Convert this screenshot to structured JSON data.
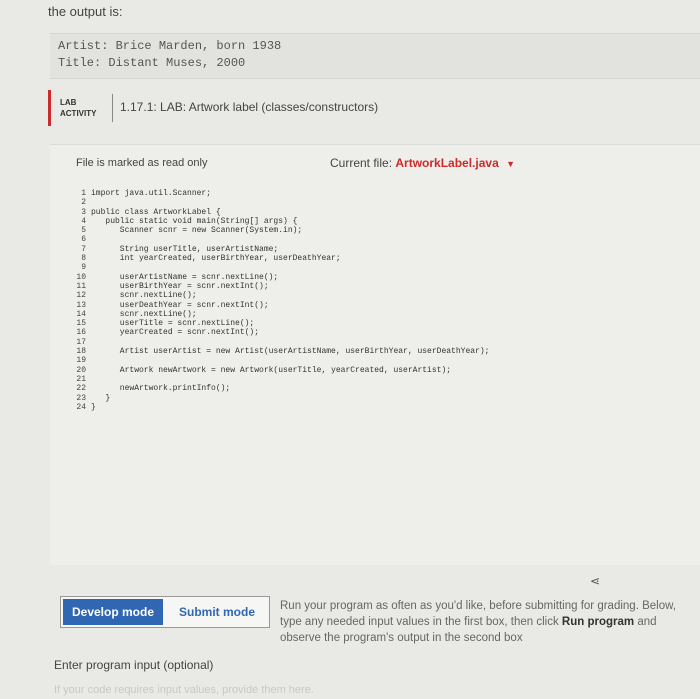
{
  "intro": "the output is:",
  "output_lines": [
    "Artist: Brice Marden, born 1938",
    "Title: Distant Muses, 2000"
  ],
  "lab": {
    "tag_line1": "LAB",
    "tag_line2": "ACTIVITY",
    "title": "1.17.1: LAB: Artwork label (classes/constructors)"
  },
  "editor": {
    "readonly_text": "File is marked as read only",
    "current_file_label": "Current file:",
    "current_file_name": "ArtworkLabel.java",
    "lines": [
      {
        "n": "1",
        "t": "import java.util.Scanner;"
      },
      {
        "n": "2",
        "t": ""
      },
      {
        "n": "3",
        "t": "public class ArtworkLabel {"
      },
      {
        "n": "4",
        "t": "   public static void main(String[] args) {"
      },
      {
        "n": "5",
        "t": "      Scanner scnr = new Scanner(System.in);"
      },
      {
        "n": "6",
        "t": ""
      },
      {
        "n": "7",
        "t": "      String userTitle, userArtistName;"
      },
      {
        "n": "8",
        "t": "      int yearCreated, userBirthYear, userDeathYear;"
      },
      {
        "n": "9",
        "t": ""
      },
      {
        "n": "10",
        "t": "      userArtistName = scnr.nextLine();"
      },
      {
        "n": "11",
        "t": "      userBirthYear = scnr.nextInt();"
      },
      {
        "n": "12",
        "t": "      scnr.nextLine();"
      },
      {
        "n": "13",
        "t": "      userDeathYear = scnr.nextInt();"
      },
      {
        "n": "14",
        "t": "      scnr.nextLine();"
      },
      {
        "n": "15",
        "t": "      userTitle = scnr.nextLine();"
      },
      {
        "n": "16",
        "t": "      yearCreated = scnr.nextInt();"
      },
      {
        "n": "17",
        "t": ""
      },
      {
        "n": "18",
        "t": "      Artist userArtist = new Artist(userArtistName, userBirthYear, userDeathYear);"
      },
      {
        "n": "19",
        "t": ""
      },
      {
        "n": "20",
        "t": "      Artwork newArtwork = new Artwork(userTitle, yearCreated, userArtist);"
      },
      {
        "n": "21",
        "t": ""
      },
      {
        "n": "22",
        "t": "      newArtwork.printInfo();"
      },
      {
        "n": "23",
        "t": "   }"
      },
      {
        "n": "24",
        "t": "}"
      }
    ]
  },
  "modes": {
    "develop": "Develop mode",
    "submit": "Submit mode"
  },
  "instructions": {
    "part1": "Run your program as often as you'd like, before submitting for grading. Below, type any needed input values in the first box, then click ",
    "bold": "Run program",
    "part2": " and observe the program's output in the second box"
  },
  "input_label": "Enter program input (optional)",
  "input_placeholder": "If your code requires input values, provide them here."
}
